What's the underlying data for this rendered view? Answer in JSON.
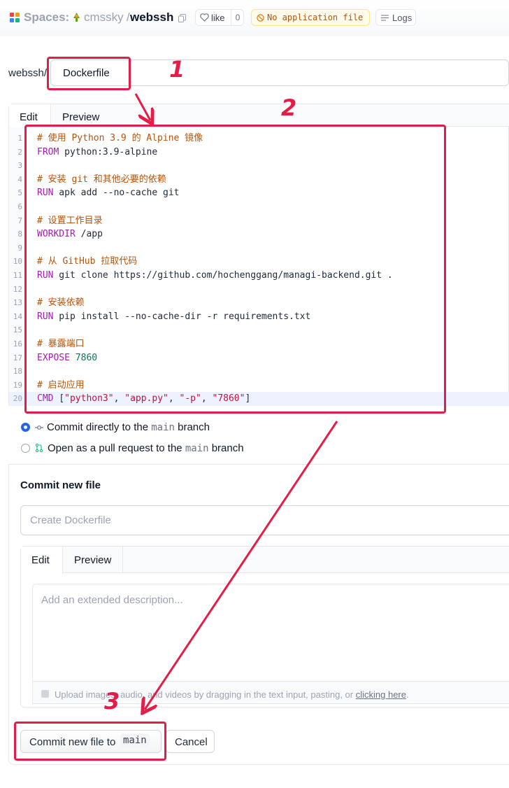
{
  "header": {
    "spaces_label": "Spaces:",
    "owner": "cmssky",
    "separator": "/",
    "repo": "webssh",
    "like_label": "like",
    "like_count": "0",
    "status_label": "No application file",
    "logs_label": "Logs"
  },
  "file": {
    "path_prefix": "webssh/",
    "filename": "Dockerfile"
  },
  "editor": {
    "tabs": [
      "Edit",
      "Preview"
    ],
    "lines": [
      [
        {
          "t": "# 使用 Python 3.9 的 Alpine 镜像",
          "c": "com"
        }
      ],
      [
        {
          "t": "FROM",
          "c": "kw"
        },
        {
          "t": " python:3.9-alpine",
          "c": ""
        }
      ],
      [],
      [
        {
          "t": "# 安装 git 和其他必要的依赖",
          "c": "com"
        }
      ],
      [
        {
          "t": "RUN",
          "c": "kw"
        },
        {
          "t": " apk add --no-cache git",
          "c": ""
        }
      ],
      [],
      [
        {
          "t": "# 设置工作目录",
          "c": "com"
        }
      ],
      [
        {
          "t": "WORKDIR",
          "c": "kw"
        },
        {
          "t": " /app",
          "c": ""
        }
      ],
      [],
      [
        {
          "t": "# 从 GitHub 拉取代码",
          "c": "com"
        }
      ],
      [
        {
          "t": "RUN",
          "c": "kw"
        },
        {
          "t": " git clone https://github.com/hochenggang/managi-backend.git .",
          "c": ""
        }
      ],
      [],
      [
        {
          "t": "# 安装依赖",
          "c": "com"
        }
      ],
      [
        {
          "t": "RUN",
          "c": "kw"
        },
        {
          "t": " pip install --no-cache-dir -r requirements.txt",
          "c": ""
        }
      ],
      [],
      [
        {
          "t": "# 暴露端口",
          "c": "com"
        }
      ],
      [
        {
          "t": "EXPOSE",
          "c": "kw"
        },
        {
          "t": " ",
          "c": ""
        },
        {
          "t": "7860",
          "c": "num"
        }
      ],
      [],
      [
        {
          "t": "# 启动应用",
          "c": "com"
        }
      ],
      [
        {
          "t": "CMD",
          "c": "kw"
        },
        {
          "t": " [",
          "c": ""
        },
        {
          "t": "\"python3\"",
          "c": "str"
        },
        {
          "t": ", ",
          "c": ""
        },
        {
          "t": "\"app.py\"",
          "c": "str"
        },
        {
          "t": ", ",
          "c": ""
        },
        {
          "t": "\"-p\"",
          "c": "str"
        },
        {
          "t": ", ",
          "c": ""
        },
        {
          "t": "\"7860\"",
          "c": "str"
        },
        {
          "t": "]",
          "c": ""
        }
      ]
    ]
  },
  "commit_options": {
    "direct_pre": "Commit directly to the",
    "direct_branch": "main",
    "direct_post": "branch",
    "pr_pre": "Open as a pull request to the",
    "pr_branch": "main",
    "pr_post": "branch"
  },
  "commit": {
    "title": "Commit new file",
    "summary_placeholder": "Create Dockerfile",
    "desc_tab_edit": "Edit",
    "desc_tab_preview": "Preview",
    "desc_placeholder": "Add an extended description...",
    "upload_text": "Upload images, audio, and videos by dragging in the text input, pasting, or",
    "upload_link": "clicking here",
    "upload_tail": ".",
    "commit_button": "Commit new file to",
    "commit_branch": "main",
    "cancel_button": "Cancel"
  },
  "annotations": [
    "1",
    "2",
    "3"
  ],
  "colors": {
    "annotation": "#e11d48",
    "keyword": "#a21caf",
    "comment": "#b45309",
    "string": "#be123c",
    "radio_selected": "#2563eb"
  }
}
